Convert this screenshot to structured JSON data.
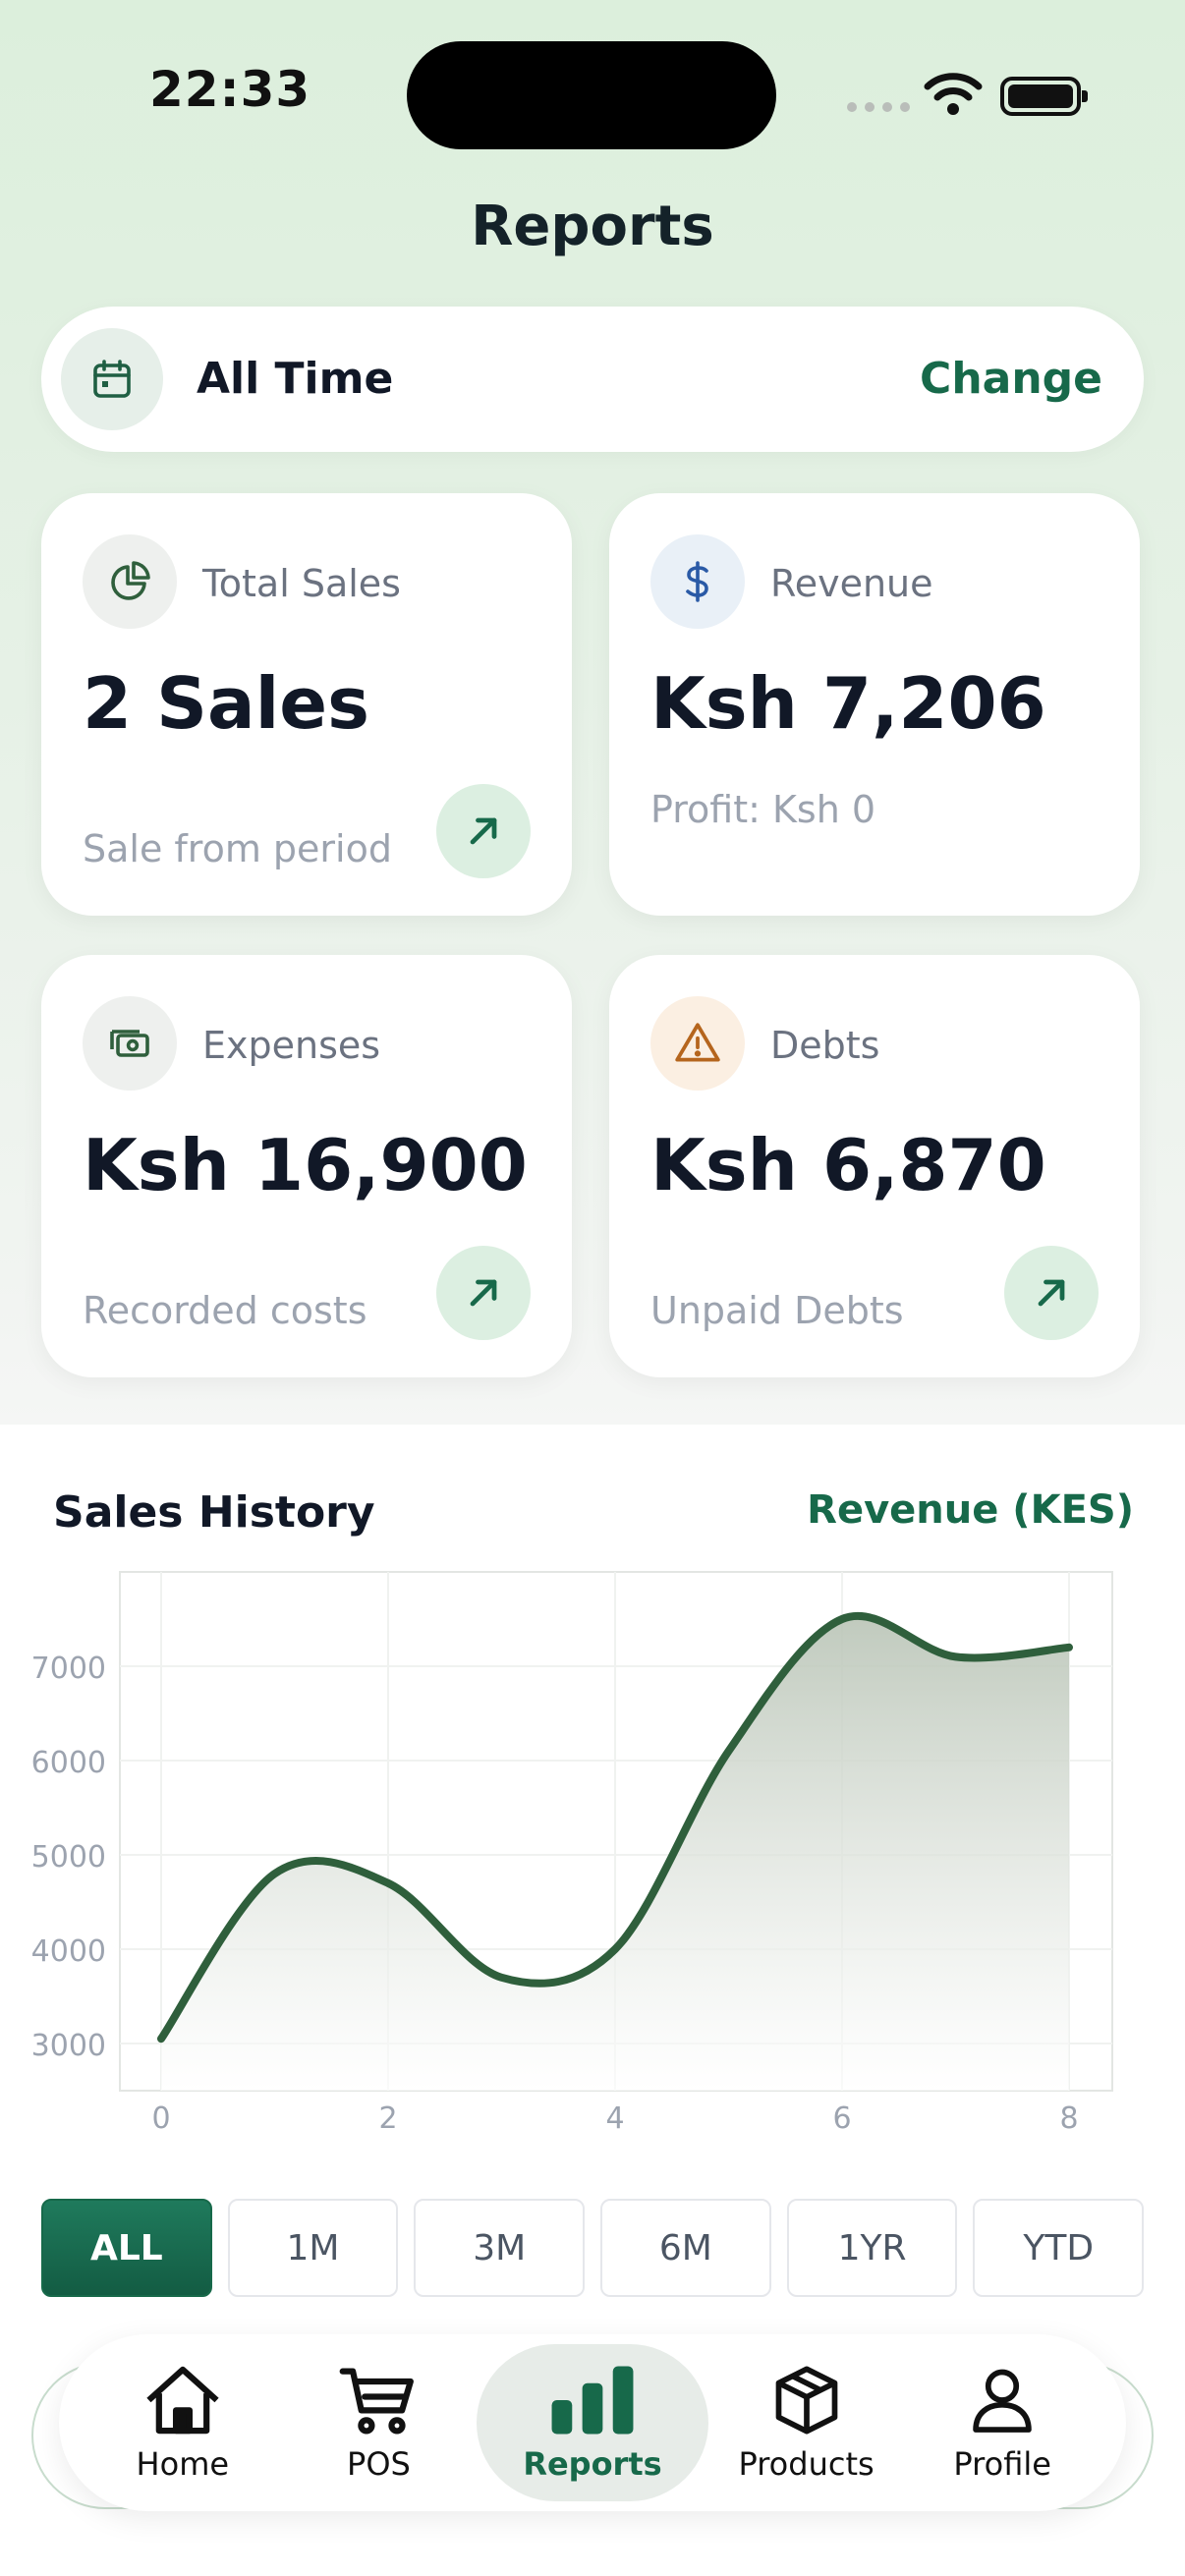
{
  "status": {
    "time": "22:33"
  },
  "header": {
    "title": "Reports"
  },
  "period": {
    "label": "All Time",
    "change_label": "Change"
  },
  "cards": [
    {
      "label": "Total Sales",
      "value": "2 Sales",
      "sub": "Sale from period",
      "icon": "pie-chart-icon"
    },
    {
      "label": "Revenue",
      "value": "Ksh 7,206",
      "sub": "Profit: Ksh 0",
      "icon": "dollar-icon"
    },
    {
      "label": "Expenses",
      "value": "Ksh 16,900",
      "sub": "Recorded costs",
      "icon": "cash-icon"
    },
    {
      "label": "Debts",
      "value": "Ksh 6,870",
      "sub": "Unpaid Debts",
      "icon": "warning-icon"
    }
  ],
  "chart_section": {
    "title": "Sales History",
    "metric": "Revenue (KES)"
  },
  "chart_data": {
    "type": "area",
    "title": "",
    "x": [
      0,
      1,
      2,
      3,
      4,
      5,
      6,
      7,
      8
    ],
    "series": [
      {
        "values": [
          3050,
          4800,
          4700,
          3700,
          4000,
          6100,
          7500,
          7100,
          7200
        ]
      }
    ],
    "xticks": [
      0,
      2,
      4,
      6,
      8
    ],
    "yticks": [
      3000,
      4000,
      5000,
      6000,
      7000
    ],
    "xlim": [
      0,
      8
    ],
    "ylim": [
      2500,
      8000
    ],
    "grid": true,
    "line_color": "#2f5f3c"
  },
  "ranges": [
    {
      "label": "ALL",
      "active": true
    },
    {
      "label": "1M"
    },
    {
      "label": "3M"
    },
    {
      "label": "6M"
    },
    {
      "label": "1YR"
    },
    {
      "label": "YTD"
    }
  ],
  "nav": [
    {
      "label": "Home",
      "icon": "home-icon"
    },
    {
      "label": "POS",
      "icon": "cart-icon"
    },
    {
      "label": "Reports",
      "icon": "bar-chart-icon",
      "active": true
    },
    {
      "label": "Products",
      "icon": "box-icon"
    },
    {
      "label": "Profile",
      "icon": "user-icon"
    }
  ],
  "colors": {
    "accent": "#17694a",
    "accent_light": "#dcefe1"
  }
}
